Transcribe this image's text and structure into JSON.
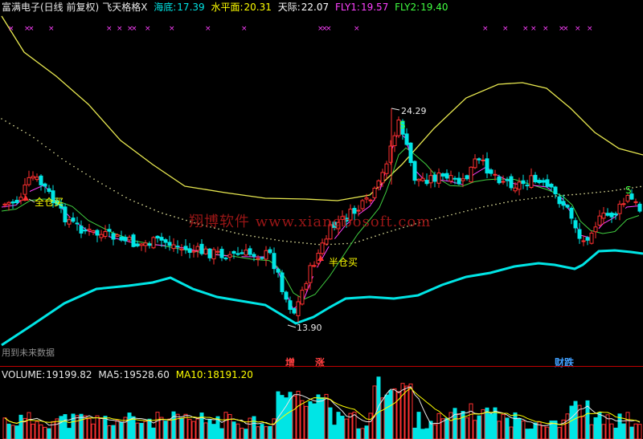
{
  "header": {
    "title": "富满电子(日线 前复权)",
    "indicator": "飞天格格X",
    "items": [
      {
        "label": "海底:",
        "value": "17.39",
        "color": "#00e5e5"
      },
      {
        "label": "水平面:",
        "value": "20.31",
        "color": "#ffff00"
      },
      {
        "label": "天际:",
        "value": "22.07",
        "color": "#ffffff"
      },
      {
        "label": "FLY1:",
        "value": "19.57",
        "color": "#ff40ff"
      },
      {
        "label": "FLY2:",
        "value": "19.40",
        "color": "#40ff40"
      }
    ]
  },
  "annotations": {
    "high_label": "24.29",
    "low_label": "13.90",
    "sell_marks": [
      "S",
      "S"
    ],
    "full_buy": "全仓买",
    "half_buy": "半仓买",
    "future_data": "用到未来数据",
    "watermark": "翔博软件  www.xiangbosoft.com"
  },
  "indicator_labels": [
    {
      "text": "增",
      "color": "#ff4040"
    },
    {
      "text": "涨",
      "color": "#ff4040"
    },
    {
      "text": "财跌",
      "color": "#40a0ff"
    }
  ],
  "volume": {
    "label": "VOLUME:",
    "value": "19199.82",
    "ma5_label": "MA5:",
    "ma5_value": "19528.60",
    "ma10_label": "MA10:",
    "ma10_value": "18191.20"
  },
  "colors": {
    "up": "#ff3030",
    "down": "#00e5e5",
    "upper_band": "#e8e850",
    "lower_band": "#00e5e5",
    "mid_dots": "#e8e8a0",
    "fly1": "#ff40ff",
    "fly2": "#40d040",
    "x_marker": "#ff40ff"
  }
}
